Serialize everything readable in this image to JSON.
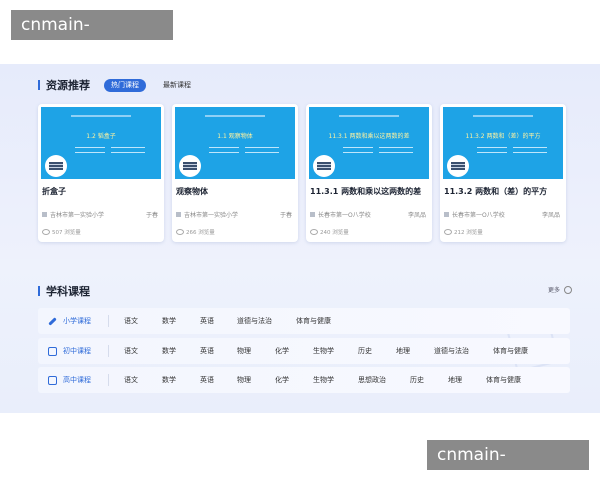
{
  "watermark": "cnmain-jiuyou.com",
  "resources": {
    "title": "资源推荐",
    "tabs": [
      {
        "label": "热门课程",
        "active": true
      },
      {
        "label": "最新课程",
        "active": false
      }
    ],
    "cards": [
      {
        "thumb_caption": "1.2 韬盒子",
        "title": "折盒子",
        "school": "吉林市第一实验小学",
        "author": "于春",
        "views": "507 浏览量"
      },
      {
        "thumb_caption": "1.1 观察物体",
        "title": "观察物体",
        "school": "吉林市第一实验小学",
        "author": "于春",
        "views": "266 浏览量"
      },
      {
        "thumb_caption": "11.3.1 两数和乘以这两数的差",
        "title": "11.3.1 两数和乘以这两数的差",
        "school": "长春市第一O八学校",
        "author": "李凤品",
        "views": "240 浏览量"
      },
      {
        "thumb_caption": "11.3.2 两数和（差）的平方",
        "title": "11.3.2 两数和（差）的平方",
        "school": "长春市第一O八学校",
        "author": "李凤品",
        "views": "212 浏览量"
      }
    ]
  },
  "subjects": {
    "title": "学科课程",
    "more_label": "更多",
    "rows": [
      {
        "label": "小学课程",
        "items": [
          "语文",
          "数学",
          "英语",
          "道德与法治",
          "体育与健康"
        ]
      },
      {
        "label": "初中课程",
        "items": [
          "语文",
          "数学",
          "英语",
          "物理",
          "化学",
          "生物学",
          "历史",
          "地理",
          "道德与法治",
          "体育与健康"
        ]
      },
      {
        "label": "高中课程",
        "items": [
          "语文",
          "数学",
          "英语",
          "物理",
          "化学",
          "生物学",
          "思想政治",
          "历史",
          "地理",
          "体育与健康"
        ]
      }
    ]
  },
  "colors": {
    "accent": "#2f6bd9",
    "thumb_bg": "#1ea3e6"
  }
}
